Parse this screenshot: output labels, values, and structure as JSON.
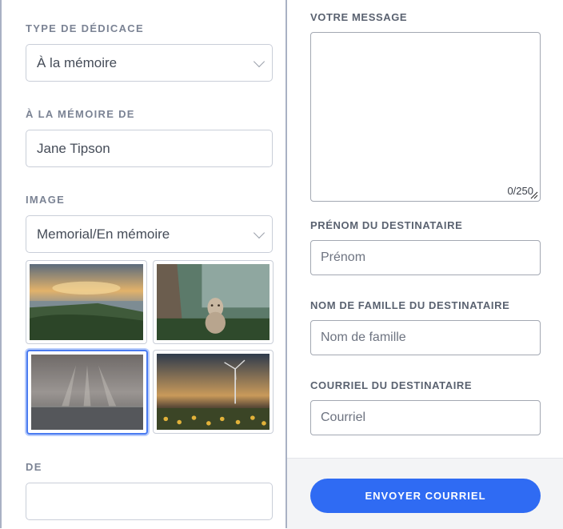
{
  "left": {
    "dedication_type": {
      "label": "TYPE DE DÉDICACE",
      "value": "À la mémoire"
    },
    "memory_of": {
      "label": "À LA MÉMOIRE DE",
      "value": "Jane Tipson"
    },
    "image": {
      "label": "IMAGE",
      "value": "Memorial/En mémoire"
    },
    "thumbnails": [
      {
        "name": "beach-dunes-sunset",
        "selected": false
      },
      {
        "name": "lynx-forest",
        "selected": false
      },
      {
        "name": "sea-sunrays",
        "selected": true
      },
      {
        "name": "sunflowers-wind-turbine",
        "selected": false
      }
    ],
    "from": {
      "label": "DE",
      "value": ""
    }
  },
  "right": {
    "message": {
      "label": "VOTRE MESSAGE",
      "counter": "0/250"
    },
    "first_name": {
      "label": "PRÉNOM DU DESTINATAIRE",
      "placeholder": "Prénom"
    },
    "last_name": {
      "label": "NOM DE FAMILLE DU DESTINATAIRE",
      "placeholder": "Nom de famille"
    },
    "email": {
      "label": "COURRIEL DU DESTINATAIRE",
      "placeholder": "Courriel"
    },
    "send_label": "ENVOYER COURRIEL"
  },
  "colors": {
    "accent": "#2f6bf3",
    "selected_border": "#4a7bf0"
  }
}
